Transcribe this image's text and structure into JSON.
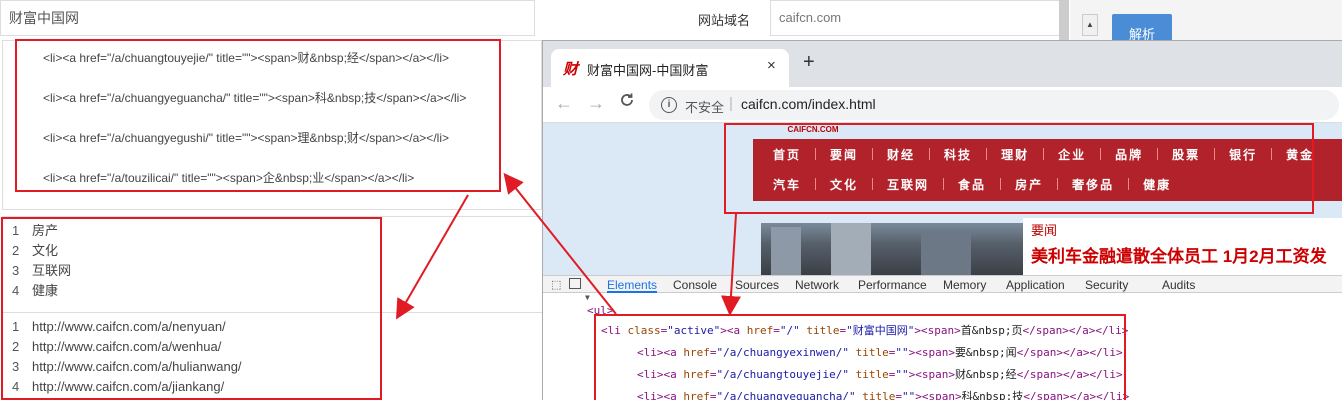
{
  "form": {
    "site_name": "财富中国网",
    "domain_label": "网站域名",
    "domain_value": "caifcn.com",
    "parse_button": "解析"
  },
  "code_lines": [
    "<li><a href=\"/a/chuangtouyejie/\" title=\"\"><span>财&nbsp;经</span></a></li>",
    "<li><a href=\"/a/chuangyeguancha/\" title=\"\"><span>科&nbsp;技</span></a></li>",
    "<li><a href=\"/a/chuangyegushi/\" title=\"\"><span>理&nbsp;财</span></a></li>",
    "<li><a href=\"/a/touzilicai/\" title=\"\"><span>企&nbsp;业</span></a></li>"
  ],
  "names_list": [
    {
      "num": "1",
      "value": "房产"
    },
    {
      "num": "2",
      "value": "文化"
    },
    {
      "num": "3",
      "value": "互联网"
    },
    {
      "num": "4",
      "value": "健康"
    }
  ],
  "urls_list": [
    {
      "num": "1",
      "value": "http://www.caifcn.com/a/nenyuan/"
    },
    {
      "num": "2",
      "value": "http://www.caifcn.com/a/wenhua/"
    },
    {
      "num": "3",
      "value": "http://www.caifcn.com/a/hulianwang/"
    },
    {
      "num": "4",
      "value": "http://www.caifcn.com/a/jiankang/"
    }
  ],
  "browser": {
    "favicon": "财",
    "tab_title": "财富中国网-中国财富",
    "close": "×",
    "new_tab": "+",
    "back": "←",
    "forward": "→",
    "reload": "C",
    "info": "i",
    "insecure": "不安全",
    "url": "caifcn.com/index.html"
  },
  "page": {
    "logo_text": "CAIFCN.COM",
    "nav_row1": [
      "首页",
      "要闻",
      "财经",
      "科技",
      "理财",
      "企业",
      "品牌",
      "股票",
      "银行",
      "黄金"
    ],
    "nav_row2": [
      "汽车",
      "文化",
      "互联网",
      "食品",
      "房产",
      "奢侈品",
      "健康"
    ],
    "news_tag": "要闻",
    "news_headline": "美利车金融遣散全体员工 1月2月工资发"
  },
  "devtools": {
    "tabs": [
      "Elements",
      "Console",
      "Sources",
      "Network",
      "Performance",
      "Memory",
      "Application",
      "Security",
      "Audits"
    ],
    "active_tab": "Elements",
    "ul_line": "<ul>",
    "dom_lines": [
      {
        "indent": 0,
        "cls": "active",
        "href": "/",
        "title": "财富中国网",
        "text": "首&nbsp;页"
      },
      {
        "indent": 1,
        "href": "/a/chuangyexinwen/",
        "title": "",
        "text": "要&nbsp;闻"
      },
      {
        "indent": 1,
        "href": "/a/chuangtouyejie/",
        "title": "",
        "text": "财&nbsp;经"
      },
      {
        "indent": 1,
        "href": "/a/chuangyeguancha/",
        "title": "",
        "text": "科&nbsp;技"
      }
    ]
  },
  "colors": {
    "annotation_red": "#e01b24",
    "nav_red": "#b2222a",
    "parse_blue": "#4a8dd6"
  }
}
